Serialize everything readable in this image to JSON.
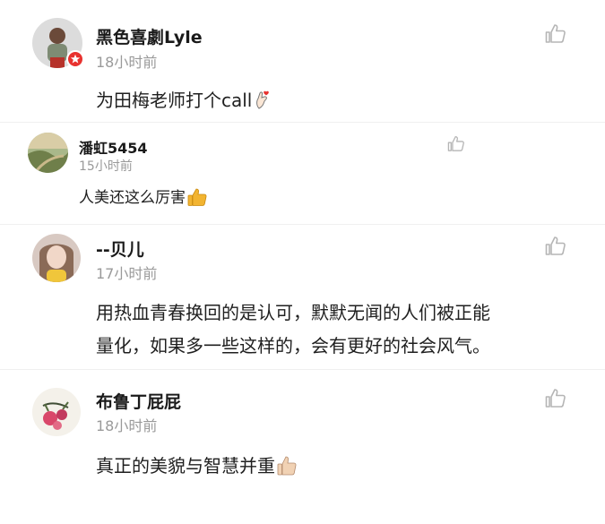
{
  "comments": [
    {
      "name": "黑色喜劇Lyle",
      "time": "18小时前",
      "text": "为田梅老师打个call",
      "emoji": "hand-heart-icon"
    },
    {
      "name": "潘虹5454",
      "time": "15小时前",
      "text": "人美还这么厉害",
      "emoji": "thumbs-up-icon"
    },
    {
      "name": "--贝儿",
      "time": "17小时前",
      "text_lines": [
        "用热血青春换回的是认可，默默无闻的人们被正能",
        "量化，如果多一些这样的，会有更好的社会风气。"
      ]
    },
    {
      "name": "布鲁丁屁屁",
      "time": "18小时前",
      "text": "真正的美貌与智慧并重",
      "emoji": "thumbs-up-icon"
    }
  ],
  "colors": {
    "badge": "#e8322f",
    "time": "#9a9a9a",
    "like_icon": "#b5b5b5",
    "emoji": "#f2b431"
  }
}
